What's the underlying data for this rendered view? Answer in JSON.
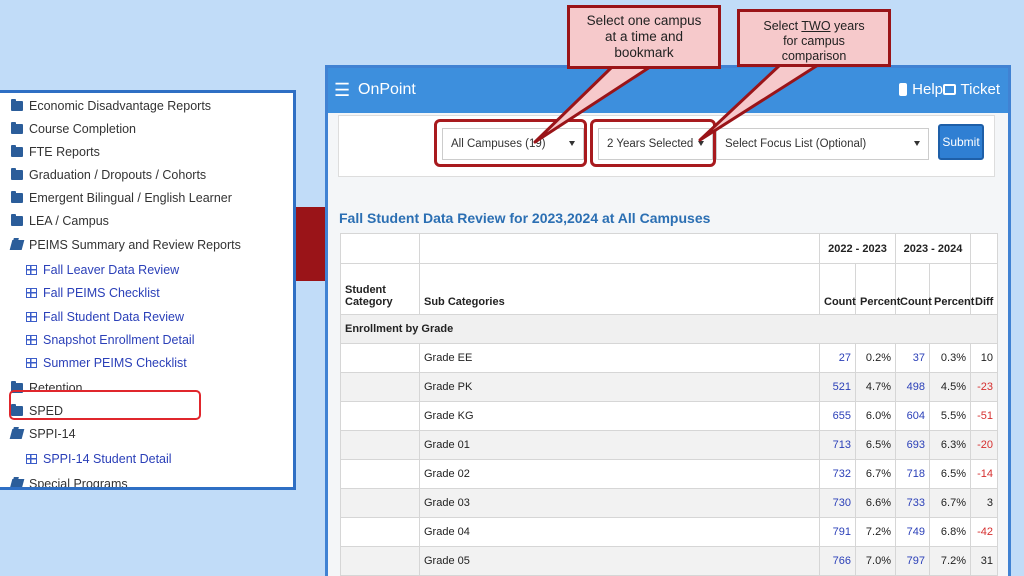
{
  "menu": {
    "items": [
      {
        "label": "Economic Disadvantage Reports",
        "type": "folder"
      },
      {
        "label": "Course Completion",
        "type": "folder"
      },
      {
        "label": "FTE Reports",
        "type": "folder"
      },
      {
        "label": "Graduation / Dropouts / Cohorts",
        "type": "folder"
      },
      {
        "label": "Emergent Bilingual / English Learner",
        "type": "folder"
      },
      {
        "label": "LEA / Campus",
        "type": "folder"
      },
      {
        "label": "PEIMS Summary and Review Reports",
        "type": "folder-open"
      },
      {
        "label": "Fall Leaver Data Review",
        "type": "report"
      },
      {
        "label": "Fall PEIMS Checklist",
        "type": "report"
      },
      {
        "label": "Fall Student Data Review",
        "type": "report"
      },
      {
        "label": "Snapshot Enrollment Detail",
        "type": "report"
      },
      {
        "label": "Summer PEIMS Checklist",
        "type": "report"
      },
      {
        "label": "Retention",
        "type": "folder"
      },
      {
        "label": "SPED",
        "type": "folder"
      },
      {
        "label": "SPPI-14",
        "type": "folder-open"
      },
      {
        "label": "SPPI-14 Student Detail",
        "type": "report"
      },
      {
        "label": "Special Programs",
        "type": "folder-open"
      }
    ]
  },
  "app": {
    "brand": "OnPoint",
    "help_label": "Help",
    "ticket_label": "Ticket"
  },
  "filters": {
    "campus": "All Campuses (19)",
    "years": "2 Years Selected",
    "focus": "Select Focus List (Optional)",
    "submit_label": "Submit"
  },
  "callouts": {
    "campus": [
      "Select one campus",
      "at a time and",
      "bookmark"
    ],
    "years_pre": "Select ",
    "years_em": "TWO",
    "years_post": " years",
    "years_lines": [
      "for campus",
      "comparison"
    ]
  },
  "report": {
    "title": "Fall Student Data Review for 2023,2024 at All Campuses",
    "headers": {
      "year1": "2022 - 2023",
      "year2": "2023 - 2024",
      "student": "Student",
      "category": "Category",
      "sub": "Sub Categories",
      "count": "Count",
      "percent": "Percent",
      "diff": "Diff"
    },
    "section": "Enrollment by Grade",
    "rows": [
      {
        "grade": "Grade EE",
        "c1": "27",
        "p1": "0.2%",
        "c2": "37",
        "p2": "0.3%",
        "diff": "10"
      },
      {
        "grade": "Grade PK",
        "c1": "521",
        "p1": "4.7%",
        "c2": "498",
        "p2": "4.5%",
        "diff": "-23"
      },
      {
        "grade": "Grade KG",
        "c1": "655",
        "p1": "6.0%",
        "c2": "604",
        "p2": "5.5%",
        "diff": "-51"
      },
      {
        "grade": "Grade 01",
        "c1": "713",
        "p1": "6.5%",
        "c2": "693",
        "p2": "6.3%",
        "diff": "-20"
      },
      {
        "grade": "Grade 02",
        "c1": "732",
        "p1": "6.7%",
        "c2": "718",
        "p2": "6.5%",
        "diff": "-14"
      },
      {
        "grade": "Grade 03",
        "c1": "730",
        "p1": "6.6%",
        "c2": "733",
        "p2": "6.7%",
        "diff": "3"
      },
      {
        "grade": "Grade 04",
        "c1": "791",
        "p1": "7.2%",
        "c2": "749",
        "p2": "6.8%",
        "diff": "-42"
      },
      {
        "grade": "Grade 05",
        "c1": "766",
        "p1": "7.0%",
        "c2": "797",
        "p2": "7.2%",
        "diff": "31"
      }
    ]
  },
  "colors": {
    "background": "#c1dcf8",
    "topbar": "#3d8fdd",
    "link": "#2a3fb8",
    "negative": "#d62f2f",
    "callout_border": "#9a1418",
    "callout_fill": "#f6c9cb"
  }
}
